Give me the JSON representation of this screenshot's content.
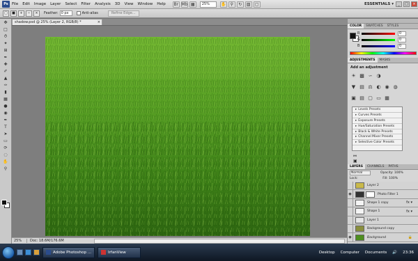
{
  "menubar": {
    "logo": "Ps",
    "items": [
      "File",
      "Edit",
      "Image",
      "Layer",
      "Select",
      "Filter",
      "Analysis",
      "3D",
      "View",
      "Window",
      "Help"
    ],
    "zoom": "25%",
    "workspace": "ESSENTIALS ▾"
  },
  "options": {
    "feather_label": "Feather:",
    "feather_value": "0 px",
    "antialias_label": "Anti-alias",
    "refine_label": "Refine Edge..."
  },
  "document": {
    "tab_title": "shadow.psd @ 25% (Layer 2, RGB/8) *",
    "status_zoom": "25%",
    "status_doc": "Doc: 18.6M/176.6M"
  },
  "color_panel": {
    "tabs": [
      "COLOR",
      "SWATCHES",
      "STYLES"
    ],
    "channels": [
      {
        "label": "R",
        "value": "0"
      },
      {
        "label": "G",
        "value": "0"
      },
      {
        "label": "B",
        "value": "0"
      }
    ]
  },
  "adjustments_panel": {
    "tabs": [
      "ADJUSTMENTS",
      "MASKS"
    ],
    "title": "Add an adjustment",
    "presets": [
      "Levels Presets",
      "Curves Presets",
      "Exposure Presets",
      "Hue/Saturation Presets",
      "Black & White Presets",
      "Channel Mixer Presets",
      "Selective Color Presets"
    ]
  },
  "layers_panel": {
    "tabs": [
      "LAYERS",
      "CHANNELS",
      "PATHS"
    ],
    "blend_mode": "Normal",
    "opacity_label": "Opacity: 100%",
    "lock_label": "Lock:",
    "fill_label": "Fill: 100%",
    "layers": [
      {
        "name": "Layer 2"
      },
      {
        "name": "Photo Filter 1"
      },
      {
        "name": "Shape 1 copy"
      },
      {
        "name": "Shape 1"
      },
      {
        "name": "Layer 1"
      },
      {
        "name": "Background copy"
      },
      {
        "name": "Background"
      }
    ]
  },
  "taskbar": {
    "tasks": [
      "Adobe Photoshop ...",
      "IrfanView"
    ],
    "tray": [
      "Desktop",
      "Computer",
      "Documents"
    ],
    "clock": "23:36"
  },
  "colors": {
    "grass_dark": "#2f6b12",
    "grass_light": "#5fa826",
    "taskbar": "#1b2738"
  }
}
